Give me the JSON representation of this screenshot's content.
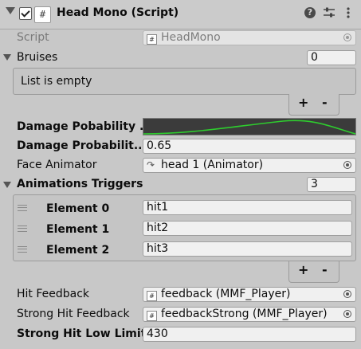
{
  "header": {
    "title": "Head Mono (Script)"
  },
  "script": {
    "label": "Script",
    "value": "HeadMono"
  },
  "bruises": {
    "label": "Bruises",
    "count": "0",
    "empty_text": "List is empty",
    "add": "+",
    "remove": "-"
  },
  "damage_prob_curve": {
    "label": "Damage Pobability ...",
    "curve_color": "#2ecc2e"
  },
  "damage_prob": {
    "label": "Damage Probabilit...",
    "value": "0.65"
  },
  "face_animator": {
    "label": "Face Animator",
    "value": "head 1 (Animator)"
  },
  "anim_triggers": {
    "label": "Animations Triggers",
    "count": "3",
    "elements": [
      {
        "label": "Element 0",
        "value": "hit1"
      },
      {
        "label": "Element 1",
        "value": "hit2"
      },
      {
        "label": "Element 2",
        "value": "hit3"
      }
    ],
    "add": "+",
    "remove": "-"
  },
  "hit_feedback": {
    "label": "Hit Feedback",
    "value": "feedback (MMF_Player)"
  },
  "strong_hit_feedback": {
    "label": "Strong Hit Feedback",
    "value": "feedbackStrong (MMF_Player)"
  },
  "strong_hit_low_limit": {
    "label": "Strong Hit Low Limit",
    "value": "430"
  },
  "icons": {
    "help": "help-icon",
    "presets": "presets-icon",
    "menu": "kebab-menu-icon"
  }
}
